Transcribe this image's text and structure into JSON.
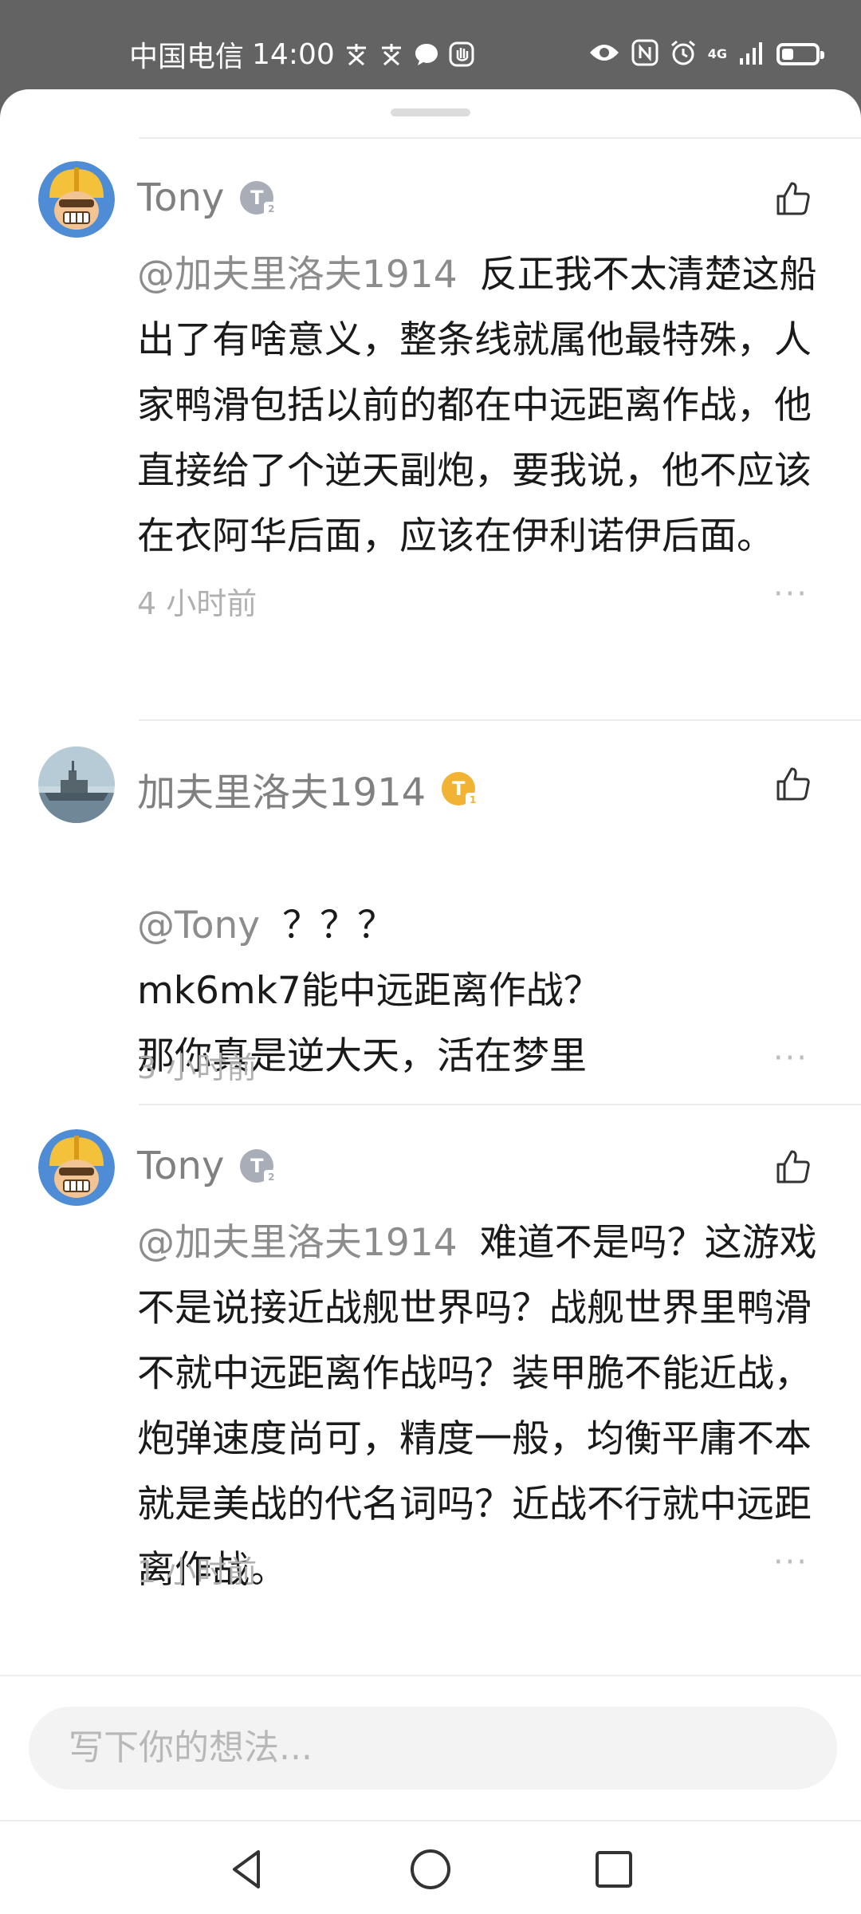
{
  "status_bar": {
    "carrier": "中国电信",
    "time": "14:00",
    "network": "4G",
    "icons": [
      "app-notification-icon",
      "app-notification-icon",
      "message-icon",
      "hand-icon",
      "eye-icon",
      "nfc-icon",
      "alarm-icon",
      "signal-icon",
      "battery-icon"
    ],
    "battery_level": 0.35
  },
  "comments": [
    {
      "username": "Tony",
      "badge": {
        "letter": "T",
        "level": "2",
        "color": "#a9adb8"
      },
      "mention": "@加夫里洛夫1914",
      "text": "反正我不太清楚这船出了有啥意义，整条线就属他最特殊，人家鸭滑包括以前的都在中远距离作战，他直接给了个逆天副炮，要我说，他不应该在衣阿华后面，应该在伊利诺伊后面。",
      "time": "4 小时前",
      "more": "···"
    },
    {
      "username": "加夫里洛夫1914",
      "badge": {
        "letter": "T",
        "level": "1",
        "color": "#f2b233"
      },
      "mention": "@Tony",
      "text": "？？？\nmk6mk7能中远距离作战？\n那你真是逆大天，活在梦里",
      "time": "3 小时前",
      "more": "···"
    },
    {
      "username": "Tony",
      "badge": {
        "letter": "T",
        "level": "2",
        "color": "#a9adb8"
      },
      "mention": "@加夫里洛夫1914",
      "text": "难道不是吗？这游戏不是说接近战舰世界吗？战舰世界里鸭滑不就中远距离作战吗？装甲脆不能近战，炮弹速度尚可，精度一般，均衡平庸不本就是美战的代名词吗？近战不行就中远距离作战。",
      "time": "1 小时前",
      "more": "···"
    }
  ],
  "input": {
    "placeholder": "写下你的想法..."
  }
}
